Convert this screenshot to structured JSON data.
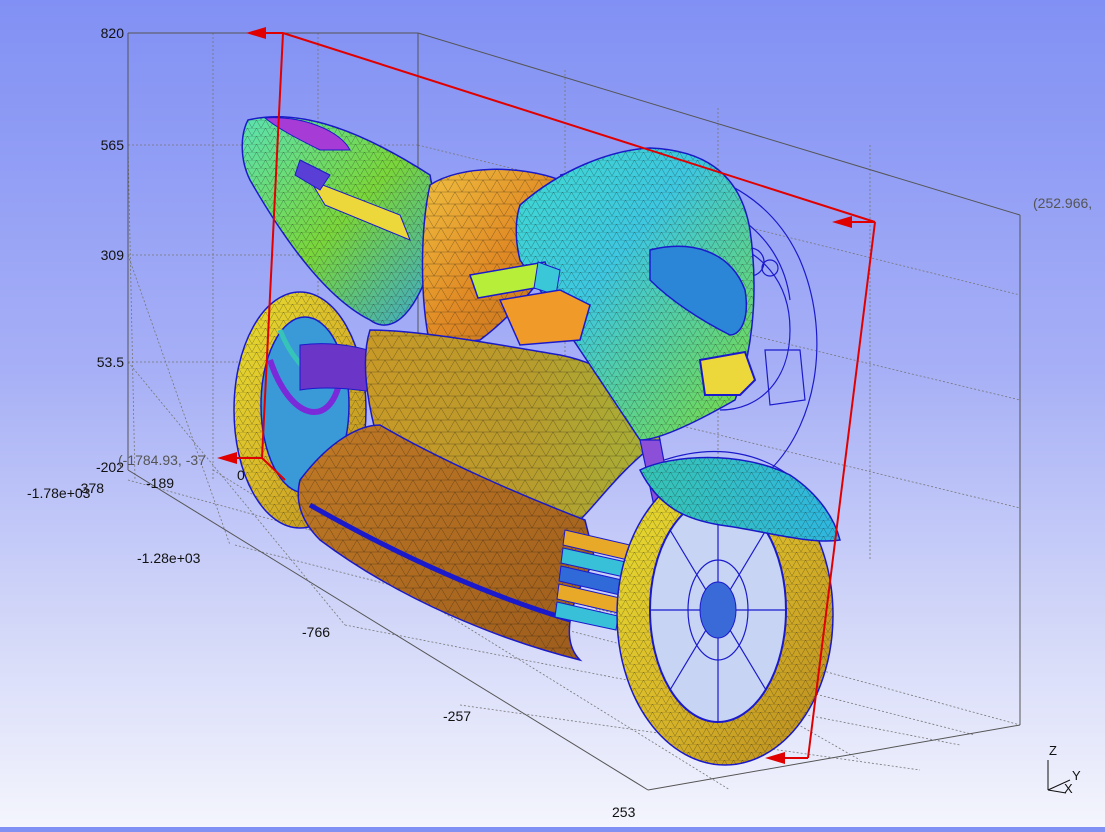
{
  "z_ticks": [
    "820",
    "565",
    "309",
    "53.5",
    "-202"
  ],
  "y_ticks": [
    "-1.78e+03",
    "-1.28e+03",
    "-766",
    "-257",
    "253"
  ],
  "x_ticks": [
    "-378",
    "-189",
    "0"
  ],
  "corner_labels": {
    "max": "(252.966,",
    "min": "(-1784.93, -37"
  },
  "triad": {
    "z": "Z",
    "y": "Y",
    "x": "X"
  },
  "colors": {
    "background_top": "#8190f4",
    "background_bottom": "#f4f5fd",
    "bbox_lines": "#555555",
    "grid_lines": "#777777",
    "clip_plane": "#e00000",
    "mesh_wire": "#1a1acc"
  }
}
